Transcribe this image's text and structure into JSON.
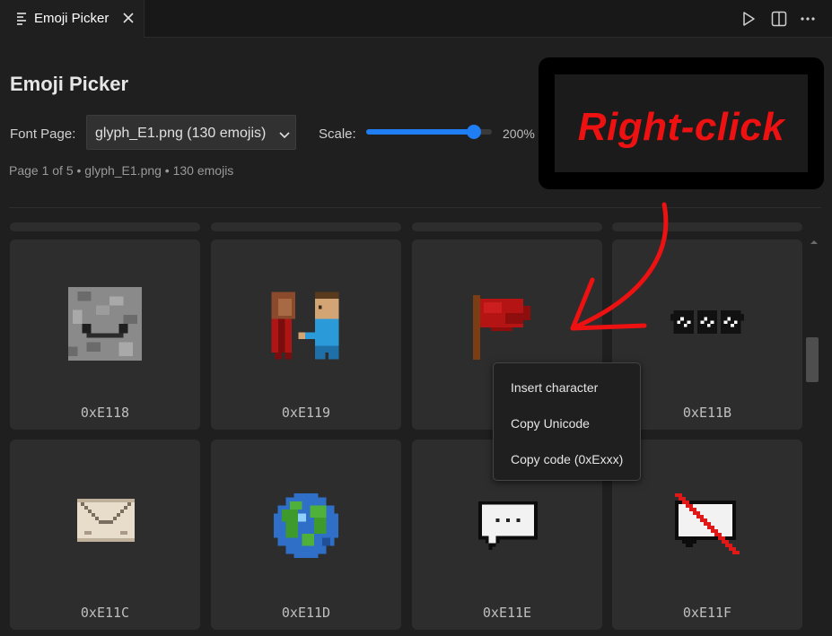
{
  "tab": {
    "title": "Emoji Picker",
    "icon": "preview-icon",
    "close_icon": "close-icon"
  },
  "toolbar": {
    "run_icon": "play-icon",
    "split_icon": "split-editor-icon",
    "more_icon": "more-actions-icon"
  },
  "header": {
    "title": "Emoji Picker",
    "font_page_label": "Font Page:",
    "font_page_value": "glyph_E1.png (130 emojis)",
    "scale_label": "Scale:",
    "scale_value": "200%",
    "scale_fraction": 0.9,
    "page_info": "Page 1 of 5 • glyph_E1.png • 130 emojis"
  },
  "annotation": {
    "text": "Right-click",
    "color": "#ee1111"
  },
  "grid": {
    "rows": [
      [
        {
          "code": "0xE118",
          "emoji": "stone-face-icon"
        },
        {
          "code": "0xE119",
          "emoji": "two-people-icon"
        },
        {
          "code": "0x",
          "emoji": "red-flag-icon"
        },
        {
          "code": "0xE11B",
          "emoji": "pixel-sunglasses-icon"
        }
      ],
      [
        {
          "code": "0xE11C",
          "emoji": "envelope-icon"
        },
        {
          "code": "0xE11D",
          "emoji": "globe-icon"
        },
        {
          "code": "0xE11E",
          "emoji": "speech-bubble-icon"
        },
        {
          "code": "0xE11F",
          "emoji": "no-chat-icon"
        }
      ]
    ]
  },
  "context_menu": {
    "items": [
      "Insert character",
      "Copy Unicode",
      "Copy code (0xExxx)"
    ]
  }
}
